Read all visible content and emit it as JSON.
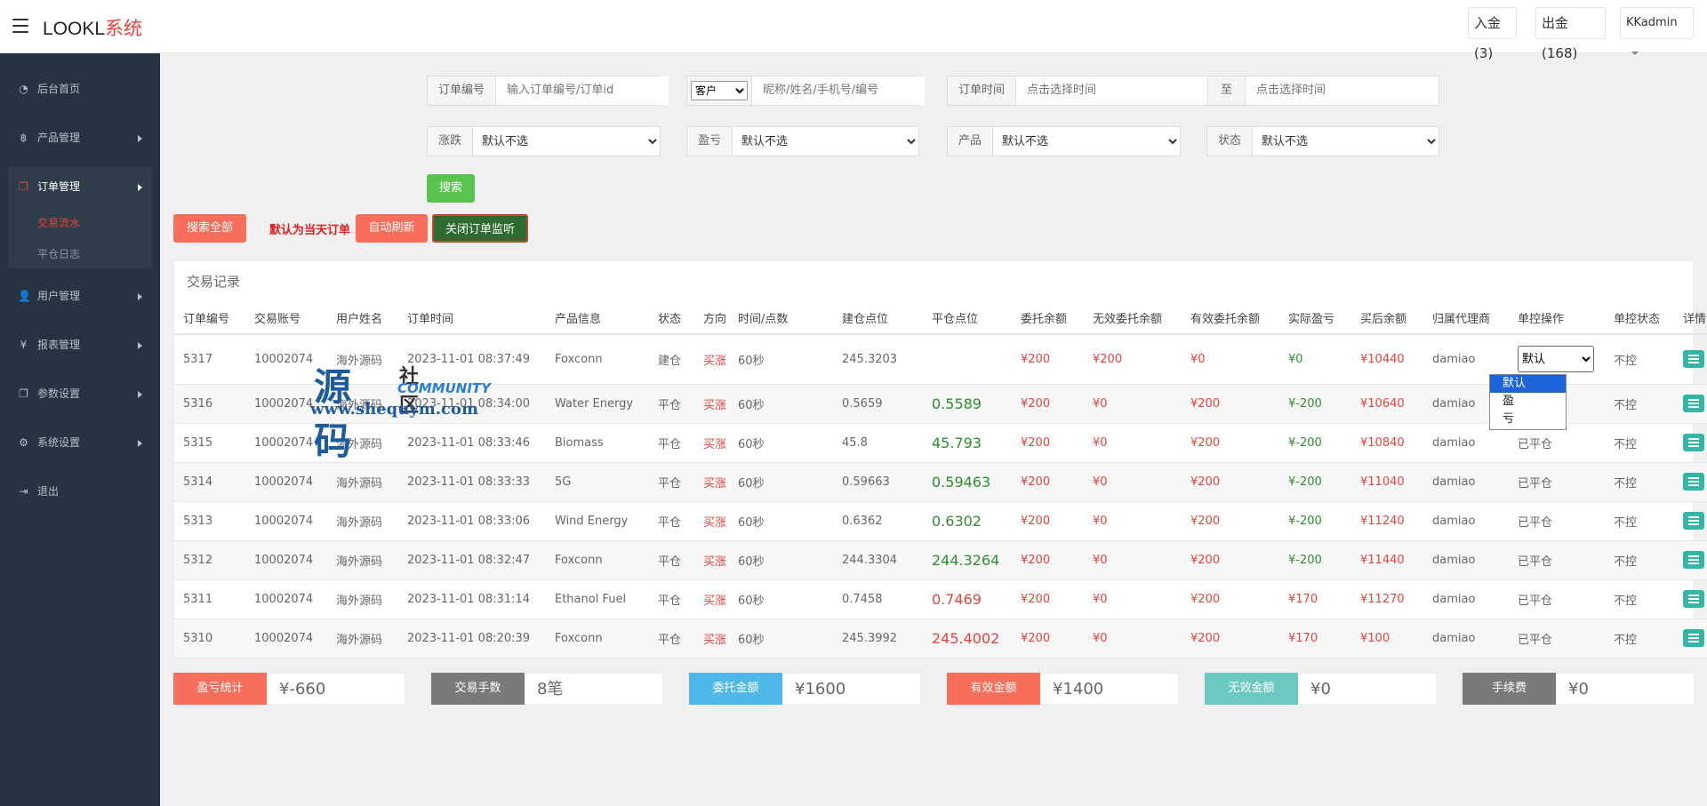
{
  "header": {
    "logo_main": "LOOKL",
    "logo_accent": "系统",
    "deposit": "入金(3)",
    "withdraw": "出金(168)",
    "admin": "KKadmin"
  },
  "sidebar": {
    "items": [
      {
        "label": "后台首页",
        "icon": "dashboard-icon"
      },
      {
        "label": "产品管理",
        "icon": "bitcoin-icon"
      },
      {
        "label": "订单管理",
        "icon": "copy-icon"
      },
      {
        "label": "用户管理",
        "icon": "user-icon"
      },
      {
        "label": "报表管理",
        "icon": "yen-icon"
      },
      {
        "label": "参数设置",
        "icon": "copy-icon"
      },
      {
        "label": "系统设置",
        "icon": "gears-icon"
      },
      {
        "label": "退出",
        "icon": "sign-out-icon"
      }
    ],
    "sub_items": [
      "交易流水",
      "平仓日志"
    ]
  },
  "filters": {
    "order_no_label": "订单编号",
    "order_no_placeholder": "输入订单编号/订单id",
    "customer_select": "客户",
    "customer_placeholder": "昵称/姓名/手机号/编号",
    "time_label": "订单时间",
    "time_start_placeholder": "点击选择时间",
    "to_label": "至",
    "time_end_placeholder": "点击选择时间",
    "rise_label": "涨跌",
    "pl_label": "盈亏",
    "product_label": "产品",
    "status_label": "状态",
    "default_option": "默认不选",
    "search": "搜索"
  },
  "actions": {
    "search_all": "搜索全部",
    "note": "默认为当天订单",
    "auto_refresh": "自动刷新",
    "close_monitor": "关闭订单监听"
  },
  "panel": {
    "title": "交易记录",
    "columns": [
      "订单编号",
      "交易账号",
      "用户姓名",
      "订单时间",
      "产品信息",
      "状态",
      "方向",
      "时间/点数",
      "建仓点位",
      "平仓点位",
      "委托余额",
      "无效委托余额",
      "有效委托余额",
      "实际盈亏",
      "买后余额",
      "归属代理商",
      "单控操作",
      "单控状态",
      "详情"
    ],
    "rows": [
      {
        "id": "5317",
        "account": "10002074",
        "name": "海外源码",
        "time": "2023-11-01 08:37:49",
        "product": "Foxconn",
        "status": "建仓",
        "dir": "买涨",
        "period": "60秒",
        "open": "245.3203",
        "close": "",
        "close_color": "",
        "entrust": "¥200",
        "invalid": "¥200",
        "valid": "¥0",
        "pl": "¥0",
        "balance": "¥10440",
        "agent": "damiao",
        "ctrl": "默认",
        "ctrl_status": "不控"
      },
      {
        "id": "5316",
        "account": "10002074",
        "name": "海外源码",
        "time": "2023-11-01 08:34:00",
        "product": "Water Energy",
        "status": "平仓",
        "dir": "买涨",
        "period": "60秒",
        "open": "0.5659",
        "close": "0.5589",
        "close_color": "green",
        "entrust": "¥200",
        "invalid": "¥0",
        "valid": "¥200",
        "pl": "¥-200",
        "balance": "¥10640",
        "agent": "damiao",
        "ctrl": "",
        "ctrl_status": "不控"
      },
      {
        "id": "5315",
        "account": "10002074",
        "name": "海外源码",
        "time": "2023-11-01 08:33:46",
        "product": "Biomass",
        "status": "平仓",
        "dir": "买涨",
        "period": "60秒",
        "open": "45.8",
        "close": "45.793",
        "close_color": "green",
        "entrust": "¥200",
        "invalid": "¥0",
        "valid": "¥200",
        "pl": "¥-200",
        "balance": "¥10840",
        "agent": "damiao",
        "ctrl": "已平仓",
        "ctrl_status": "不控"
      },
      {
        "id": "5314",
        "account": "10002074",
        "name": "海外源码",
        "time": "2023-11-01 08:33:33",
        "product": "5G",
        "status": "平仓",
        "dir": "买涨",
        "period": "60秒",
        "open": "0.59663",
        "close": "0.59463",
        "close_color": "green",
        "entrust": "¥200",
        "invalid": "¥0",
        "valid": "¥200",
        "pl": "¥-200",
        "balance": "¥11040",
        "agent": "damiao",
        "ctrl": "已平仓",
        "ctrl_status": "不控"
      },
      {
        "id": "5313",
        "account": "10002074",
        "name": "海外源码",
        "time": "2023-11-01 08:33:06",
        "product": "Wind Energy",
        "status": "平仓",
        "dir": "买涨",
        "period": "60秒",
        "open": "0.6362",
        "close": "0.6302",
        "close_color": "green",
        "entrust": "¥200",
        "invalid": "¥0",
        "valid": "¥200",
        "pl": "¥-200",
        "balance": "¥11240",
        "agent": "damiao",
        "ctrl": "已平仓",
        "ctrl_status": "不控"
      },
      {
        "id": "5312",
        "account": "10002074",
        "name": "海外源码",
        "time": "2023-11-01 08:32:47",
        "product": "Foxconn",
        "status": "平仓",
        "dir": "买涨",
        "period": "60秒",
        "open": "244.3304",
        "close": "244.3264",
        "close_color": "green",
        "entrust": "¥200",
        "invalid": "¥0",
        "valid": "¥200",
        "pl": "¥-200",
        "balance": "¥11440",
        "agent": "damiao",
        "ctrl": "已平仓",
        "ctrl_status": "不控"
      },
      {
        "id": "5311",
        "account": "10002074",
        "name": "海外源码",
        "time": "2023-11-01 08:31:14",
        "product": "Ethanol Fuel",
        "status": "平仓",
        "dir": "买涨",
        "period": "60秒",
        "open": "0.7458",
        "close": "0.7469",
        "close_color": "red",
        "entrust": "¥200",
        "invalid": "¥0",
        "valid": "¥200",
        "pl": "¥170",
        "balance": "¥11270",
        "agent": "damiao",
        "ctrl": "已平仓",
        "ctrl_status": "不控"
      },
      {
        "id": "5310",
        "account": "10002074",
        "name": "海外源码",
        "time": "2023-11-01 08:20:39",
        "product": "Foxconn",
        "status": "平仓",
        "dir": "买涨",
        "period": "60秒",
        "open": "245.3992",
        "close": "245.4002",
        "close_color": "red",
        "entrust": "¥200",
        "invalid": "¥0",
        "valid": "¥200",
        "pl": "¥170",
        "balance": "¥100",
        "agent": "damiao",
        "ctrl": "已平仓",
        "ctrl_status": "不控"
      }
    ]
  },
  "control_dropdown": {
    "selected": "默认",
    "options": [
      "默认",
      "盈",
      "亏"
    ]
  },
  "watermark": {
    "line1": "源码",
    "line2": "社区",
    "line3": "COMMUNITY",
    "line4": "www.shequym.com"
  },
  "stats": [
    {
      "label": "盈亏统计",
      "value": "¥-660",
      "color": "#f76e5b"
    },
    {
      "label": "交易手数",
      "value": "8笔",
      "color": "#7a7a7a"
    },
    {
      "label": "委托金额",
      "value": "¥1600",
      "color": "#4fb8e8"
    },
    {
      "label": "有效金额",
      "value": "¥1400",
      "color": "#f76e5b"
    },
    {
      "label": "无效金额",
      "value": "¥0",
      "color": "#6cc9c1"
    },
    {
      "label": "手续费",
      "value": "¥0",
      "color": "#7a7a7a"
    }
  ],
  "colors": {
    "accent_red": "#e8423b",
    "profit_green": "#2c8f2c",
    "sidebar_bg": "#263340"
  }
}
